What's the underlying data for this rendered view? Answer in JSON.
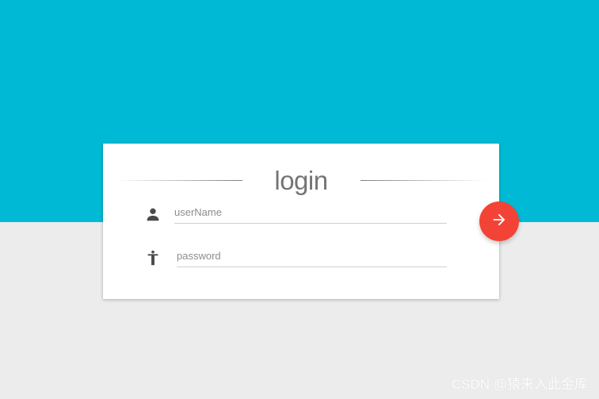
{
  "login": {
    "title": "login",
    "username_placeholder": "userName",
    "password_placeholder": "password",
    "submit_icon": "arrow-right-icon"
  },
  "icons": {
    "username": "person-icon",
    "password": "accessibility-icon"
  },
  "colors": {
    "top_background": "#00bad5",
    "bottom_background": "#ececec",
    "card_background": "#ffffff",
    "submit_button": "#f34336",
    "title_text": "#757575",
    "icon": "#4a4a4a"
  },
  "watermark": {
    "text": "CSDN @猿来入此金库"
  }
}
